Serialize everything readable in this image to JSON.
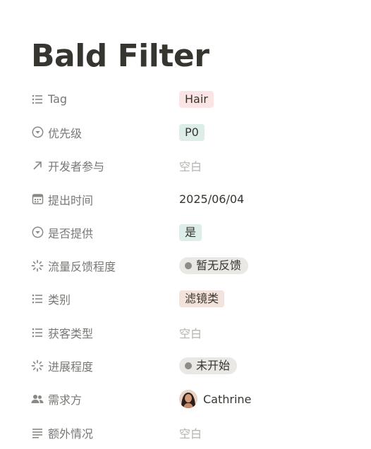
{
  "page": {
    "title": "Bald Filter"
  },
  "properties": [
    {
      "icon": "list-icon",
      "key": "Tag",
      "type": "tag",
      "value": "Hair",
      "color": "#fbe4e4"
    },
    {
      "icon": "select-icon",
      "key": "优先级",
      "type": "tag",
      "value": "P0",
      "color": "#ddedea"
    },
    {
      "icon": "arrow-up-right-icon",
      "key": "开发者参与",
      "type": "empty",
      "value": "空白"
    },
    {
      "icon": "calendar-icon",
      "key": "提出时间",
      "type": "text",
      "value": "2025/06/04"
    },
    {
      "icon": "select-icon",
      "key": "是否提供",
      "type": "tag",
      "value": "是",
      "color": "#ddedea"
    },
    {
      "icon": "status-icon",
      "key": "流量反馈程度",
      "type": "status",
      "value": "暂无反馈"
    },
    {
      "icon": "list-icon",
      "key": "类别",
      "type": "tag",
      "value": "滤镜类",
      "color": "#f4e3dc"
    },
    {
      "icon": "list-icon",
      "key": "获客类型",
      "type": "empty",
      "value": "空白"
    },
    {
      "icon": "status-icon",
      "key": "进展程度",
      "type": "status",
      "value": "未开始"
    },
    {
      "icon": "people-icon",
      "key": "需求方",
      "type": "person",
      "value": "Cathrine"
    },
    {
      "icon": "text-lines-icon",
      "key": "额外情况",
      "type": "empty",
      "value": "空白"
    }
  ]
}
